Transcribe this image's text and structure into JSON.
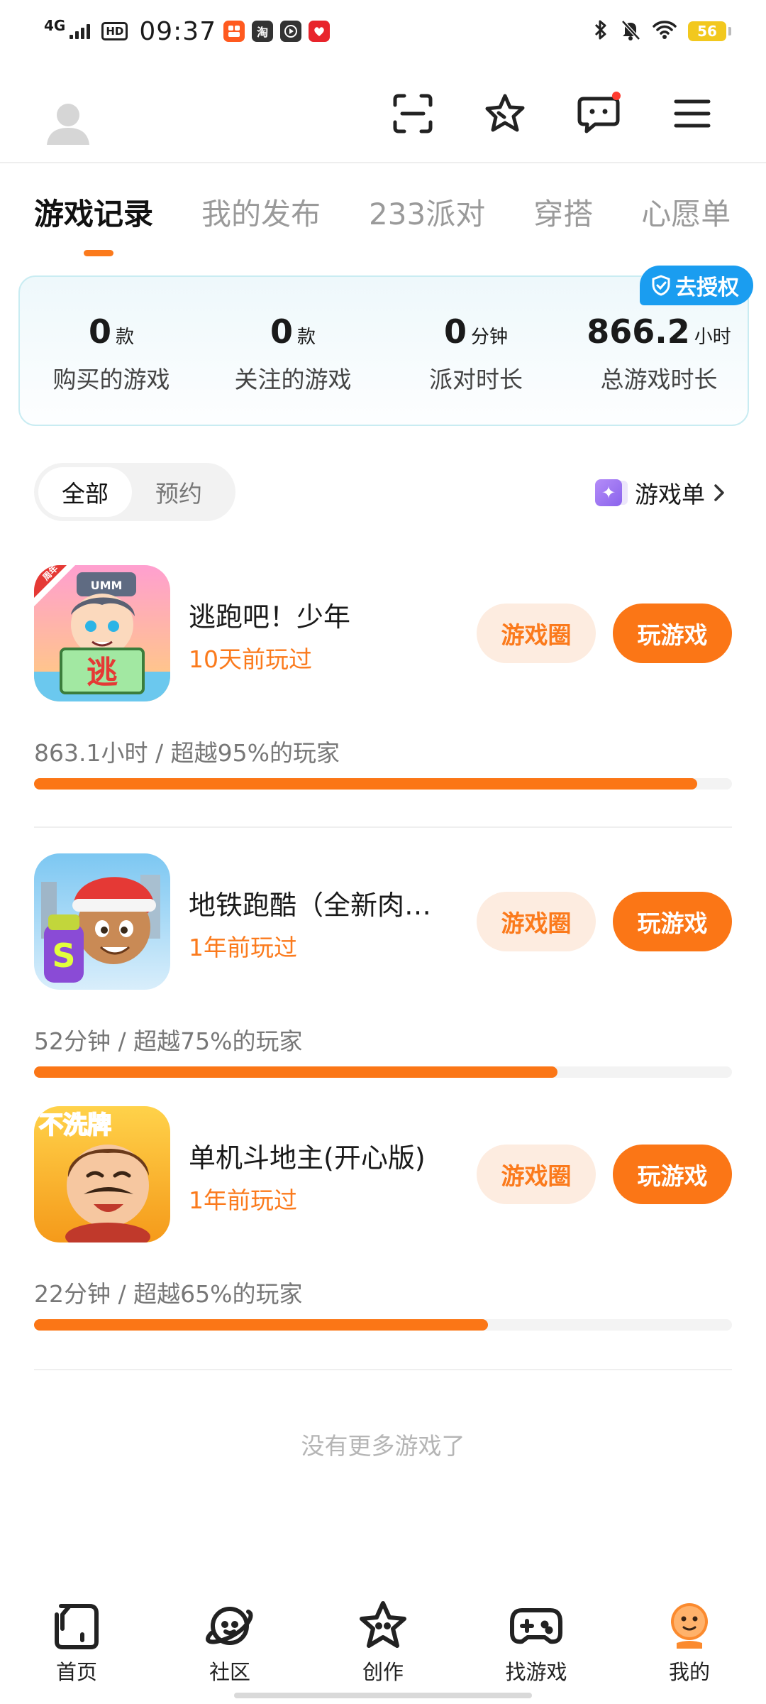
{
  "status_bar": {
    "network": "4G",
    "hd": "HD",
    "time": "09:37",
    "battery": "56",
    "app_icons": [
      {
        "name": "taobao-red-app-icon",
        "glyph": "",
        "color": "#ff5a1f"
      },
      {
        "name": "taobao-app-icon",
        "glyph": "淘",
        "color": "#333333"
      },
      {
        "name": "video-app-icon",
        "glyph": "▶",
        "color": "#333333"
      },
      {
        "name": "red-app-icon",
        "glyph": "",
        "color": "#e8242b"
      }
    ]
  },
  "tabs": [
    "游戏记录",
    "我的发布",
    "233派对",
    "穿搭",
    "心愿单"
  ],
  "active_tab": 0,
  "stats": {
    "auth_label": "去授权",
    "items": [
      {
        "value": "0",
        "unit": "款",
        "label": "购买的游戏"
      },
      {
        "value": "0",
        "unit": "款",
        "label": "关注的游戏"
      },
      {
        "value": "0",
        "unit": "分钟",
        "label": "派对时长"
      },
      {
        "value": "866.2",
        "unit": "小时",
        "label": "总游戏时长"
      }
    ]
  },
  "filter": {
    "all_label": "全部",
    "reserve_label": "预约",
    "game_list_label": "游戏单"
  },
  "games": [
    {
      "title": "逃跑吧！少年",
      "played": "10天前玩过",
      "stat_time": "863.1小时",
      "stat_rank": "超越95%的玩家",
      "progress": 0.95,
      "circle_label": "游戏圈",
      "play_label": "玩游戏",
      "icon_badge": "逃",
      "icon_corner": "周年"
    },
    {
      "title": "地铁跑酷（全新肉…",
      "played": "1年前玩过",
      "stat_time": "52分钟",
      "stat_rank": "超越75%的玩家",
      "progress": 0.75,
      "circle_label": "游戏圈",
      "play_label": "玩游戏",
      "icon_badge": "S",
      "icon_corner": ""
    },
    {
      "title": "单机斗地主(开心版)",
      "played": "1年前玩过",
      "stat_time": "22分钟",
      "stat_rank": "超越65%的玩家",
      "progress": 0.65,
      "circle_label": "游戏圈",
      "play_label": "玩游戏",
      "icon_badge": "不洗牌",
      "icon_corner": ""
    }
  ],
  "stat_separator": "/",
  "no_more": "没有更多游戏了",
  "nav": [
    {
      "label": "首页",
      "icon": "home-icon"
    },
    {
      "label": "社区",
      "icon": "community-planet-icon"
    },
    {
      "label": "创作",
      "icon": "create-star-icon"
    },
    {
      "label": "找游戏",
      "icon": "gamepad-icon"
    },
    {
      "label": "我的",
      "icon": "profile-mascot-icon"
    }
  ],
  "colors": {
    "accent": "#fb7616",
    "accent_light": "#fdece0",
    "auth_blue": "#1a9df0"
  }
}
